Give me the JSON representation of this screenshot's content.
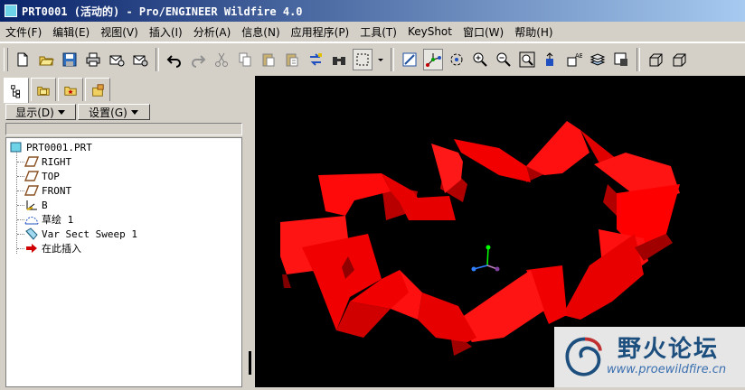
{
  "window": {
    "title": "PRT0001 (活动的) - Pro/ENGINEER Wildfire 4.0"
  },
  "menu": [
    "文件(F)",
    "编辑(E)",
    "视图(V)",
    "插入(I)",
    "分析(A)",
    "信息(N)",
    "应用程序(P)",
    "工具(T)",
    "KeyShot",
    "窗口(W)",
    "帮助(H)"
  ],
  "toolbar": {
    "icons": [
      "new-file-icon",
      "open-folder-icon",
      "save-icon",
      "print-icon",
      "send-mail-icon",
      "mail-attach-icon",
      "undo-icon",
      "redo-icon",
      "cut-icon",
      "copy-icon",
      "paste-icon",
      "paste-special-icon",
      "regenerate-icon",
      "find-icon",
      "select-box-icon",
      "repaint-icon",
      "spin-center-icon",
      "orient-icon",
      "zoom-in-icon",
      "zoom-out-icon",
      "refit-icon",
      "reorient-icon",
      "saved-views-icon",
      "layers-icon",
      "view-manager-icon",
      "shading-icon",
      "hidden-line-icon"
    ]
  },
  "left_panel": {
    "show_dropdown": "显示(D)",
    "settings_dropdown": "设置(G)",
    "tree": [
      {
        "label": "PRT0001.PRT",
        "icon": "part-icon"
      },
      {
        "label": "RIGHT",
        "icon": "datum-plane-icon"
      },
      {
        "label": "TOP",
        "icon": "datum-plane-icon"
      },
      {
        "label": "FRONT",
        "icon": "datum-plane-icon"
      },
      {
        "label": "B",
        "icon": "coord-system-icon"
      },
      {
        "label": "草绘 1",
        "icon": "sketch-icon"
      },
      {
        "label": "Var Sect Sweep 1",
        "icon": "sweep-icon"
      },
      {
        "label": "在此插入",
        "icon": "insert-here-arrow-icon"
      }
    ]
  },
  "watermark": {
    "logo_text": "野火论坛",
    "url": "www.proewildfire.cn"
  },
  "colors": {
    "model": "#ff0000",
    "viewport_bg": "#000000",
    "title_bar": "#0a246a"
  }
}
